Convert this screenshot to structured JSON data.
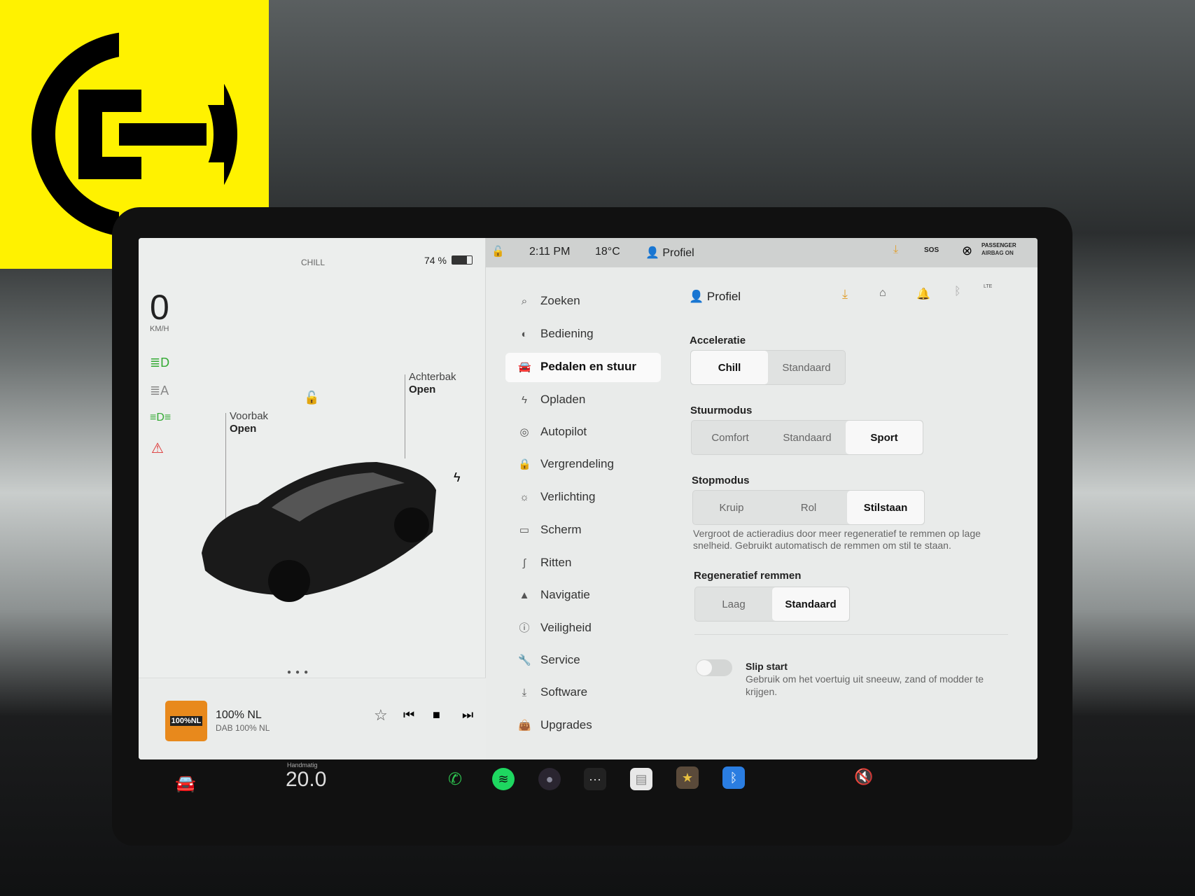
{
  "logo": {
    "name": "yellow-e-logo",
    "color": "#fff200"
  },
  "status": {
    "drive_mode": "CHILL",
    "battery": "74 %",
    "battery_level": 0.74,
    "time": "2:11 PM",
    "temp": "18°C",
    "profile": "Profiel",
    "sos": "SOS",
    "airbag": "PASSENGER",
    "airbag_state": "AIRBAG ON"
  },
  "car": {
    "speed": "0",
    "speed_unit": "KM/H",
    "frunk_label": "Voorbak",
    "frunk_state": "Open",
    "trunk_label": "Achterbak",
    "trunk_state": "Open"
  },
  "media": {
    "station": "100% NL",
    "source": "DAB 100% NL",
    "logo_text": "100%NL",
    "accent": "#e8891c"
  },
  "menu": [
    {
      "label": "Zoeken",
      "icon": "search-icon"
    },
    {
      "label": "Bediening",
      "icon": "toggle-icon"
    },
    {
      "label": "Pedalen en stuur",
      "icon": "car-icon"
    },
    {
      "label": "Opladen",
      "icon": "bolt-icon"
    },
    {
      "label": "Autopilot",
      "icon": "steering-wheel-icon"
    },
    {
      "label": "Vergrendeling",
      "icon": "lock-icon"
    },
    {
      "label": "Verlichting",
      "icon": "sun-icon"
    },
    {
      "label": "Scherm",
      "icon": "display-icon"
    },
    {
      "label": "Ritten",
      "icon": "trips-icon"
    },
    {
      "label": "Navigatie",
      "icon": "navigation-icon"
    },
    {
      "label": "Veiligheid",
      "icon": "info-icon"
    },
    {
      "label": "Service",
      "icon": "wrench-icon"
    },
    {
      "label": "Software",
      "icon": "download-icon"
    },
    {
      "label": "Upgrades",
      "icon": "bag-icon"
    }
  ],
  "settings": {
    "profile": "Profiel",
    "lte": "LTE",
    "accel": {
      "label": "Acceleratie",
      "options": [
        "Chill",
        "Standaard"
      ],
      "selected": "Chill"
    },
    "steer": {
      "label": "Stuurmodus",
      "options": [
        "Comfort",
        "Standaard",
        "Sport"
      ],
      "selected": "Sport"
    },
    "stop": {
      "label": "Stopmodus",
      "options": [
        "Kruip",
        "Rol",
        "Stilstaan"
      ],
      "selected": "Stilstaan",
      "desc": "Vergroot de actieradius door meer regeneratief te remmen op lage snelheid. Gebruikt automatisch de remmen om stil te staan."
    },
    "regen": {
      "label": "Regeneratief remmen",
      "options": [
        "Laag",
        "Standaard"
      ],
      "selected": "Standaard"
    },
    "slip": {
      "label": "Slip start",
      "desc": "Gebruik om het voertuig uit sneeuw, zand of modder te krijgen.",
      "on": false
    }
  },
  "dock": {
    "climate_mode": "Handmatig",
    "temp": "20.0"
  }
}
